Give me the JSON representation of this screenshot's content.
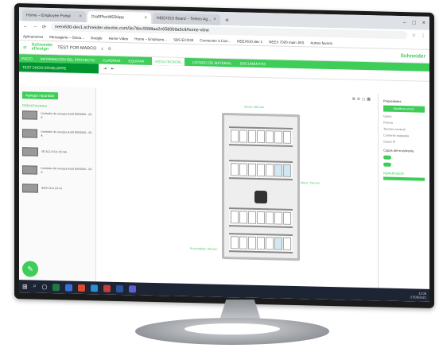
{
  "browser": {
    "tabs": [
      {
        "label": "Home – Employee Portal",
        "active": false
      },
      {
        "label": "DraftPlexWEBApp",
        "active": true
      },
      {
        "label": "NEEX010 Board – Teleeo Ag...",
        "active": false
      }
    ],
    "url": "neex630-dev1.schneider-electric.com/3e78ec5598aa2c6580b9a5c9/home-view",
    "bookmarks": [
      "Aplicaciones",
      "Messagerie – Gisou...",
      "Google",
      "Home Video",
      "Home – Employee...",
      "SBS-ECO33",
      "Connexion à Carr...",
      "NEEX610 dev 1",
      "NEEX 7020 main JNS",
      "Autres favoris"
    ]
  },
  "app": {
    "logo_line1": "Schneider",
    "logo_line2": "eDesign",
    "project": "TEST FOR MARCO",
    "brand": "Schneider",
    "menu": [
      "INICIO",
      "INFORMACIÓN DEL PROYECTO",
      "CUADROS",
      "EQUIPAR",
      "VISTA FRONTAL",
      "LISTADO DE MATERIAL",
      "DOCUMENTOS"
    ],
    "selected_menu": "VISTA FRONTAL",
    "project_name": "TEST CHOIX ENVELOPPE",
    "add_button": "Agregar repartidor",
    "section_title": "REPARTIDORES",
    "items": [
      {
        "text": "Limitador de energía Acti9 iEM3000 - 63 A"
      },
      {
        "text": "Limitador de energía Acti9 iEM3000 - 63 A"
      },
      {
        "text": "iID 4CU 63 A 30 mA"
      },
      {
        "text": "Limitador de energía Acti9 iEM3000 - 63 A"
      },
      {
        "text": "iM20 16 A 1P+N"
      }
    ],
    "dims": {
      "width": "Ancho: 600 mm",
      "height": "Altura: 750 mm",
      "depth": "Profundidad: 160 mm"
    },
    "right_panel": {
      "title": "Propiedades",
      "button": "Modificar envol.",
      "rows": [
        "Gama",
        "Prisma",
        "Tensión nominal",
        "Corriente asignada",
        "Grado IP"
      ],
      "section": "Capas del envolvente",
      "footer": "REPARTIDOR"
    },
    "taskbar_time": "11:06",
    "taskbar_date": "27/05/2021"
  },
  "colors": {
    "brand_green": "#3dcd58",
    "dark_green": "#009530",
    "taskbar": "#1d2433"
  }
}
